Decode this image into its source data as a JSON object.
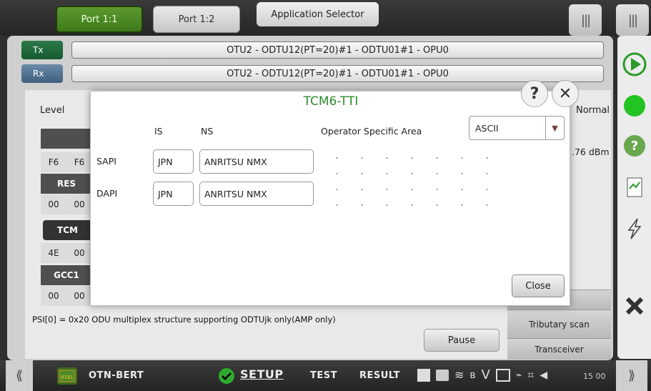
{
  "topbar": {
    "port_tabs": [
      "Port 1:1",
      "Port 1:2"
    ],
    "app_selector": "Application Selector",
    "menu_glyph": "|||"
  },
  "path": {
    "tx_label": "Tx",
    "rx_label": "Rx",
    "tx_path": "OTU2 - ODTU12(PT=20)#1 - ODTU01#1 - OPU0",
    "rx_path": "OTU2 - ODTU12(PT=20)#1 - ODTU01#1 - OPU0"
  },
  "background": {
    "level_label": "Level",
    "normal_label": "Normal",
    "dbm_label": ".76 dBm",
    "cells": {
      "f6a": "F6",
      "f6b": "F6",
      "res": "RES",
      "r00a": "00",
      "r00b": "00",
      "tcm": "TCM",
      "t4e": "4E",
      "t00": "00",
      "gcc1": "GCC1",
      "g00a": "00",
      "g00b": "00"
    },
    "psi_text": "PSI[0] = 0x20 ODU multiplex structure supporting ODTUjk only(AMP only)",
    "pause_label": "Pause",
    "side_tabs": [
      "ure",
      "Tributary scan",
      "Transceiver"
    ]
  },
  "dialog": {
    "title": "TCM6-TTI",
    "col_is": "IS",
    "col_ns": "NS",
    "col_operator": "Operator Specific Area",
    "encoding": "ASCII",
    "sapi_label": "SAPI",
    "dapi_label": "DAPI",
    "sapi_is": "JPN",
    "sapi_ns": "ANRITSU NMX",
    "dapi_is": "JPN",
    "dapi_ns": "ANRITSU NMX",
    "close_label": "Close",
    "help_glyph": "?",
    "x_glyph": "✕"
  },
  "bottombar": {
    "left_arrow": "⟪",
    "right_arrow": "⟫",
    "app_name": "OTN-BERT",
    "setup": "SETUP",
    "test": "TEST",
    "result": "RESULT",
    "clock": "15 00"
  },
  "colors": {
    "accent_green": "#2e8b2e",
    "port_active": "#4a8a24",
    "run_green": "#22c422"
  }
}
